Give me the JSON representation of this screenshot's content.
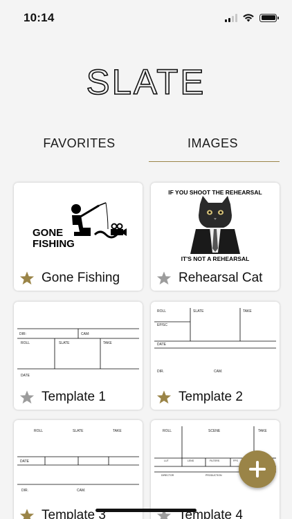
{
  "status_bar": {
    "time": "10:14",
    "icons": [
      "signal-icon",
      "wifi-icon",
      "battery-icon"
    ]
  },
  "app": {
    "logo_text": "SLATE",
    "accent_color": "#9a8447"
  },
  "tabs": [
    {
      "label": "FAVORITES",
      "active": false
    },
    {
      "label": "IMAGES",
      "active": true
    }
  ],
  "cards": [
    {
      "title": "Gone Fishing",
      "favorite": true,
      "image_text": [
        "GONE",
        "FISHING"
      ]
    },
    {
      "title": "Rehearsal Cat",
      "favorite": false,
      "image_text": [
        "IF YOU SHOOT THE REHEARSAL",
        "IT'S NOT A REHEARSAL"
      ]
    },
    {
      "title": "Template 1",
      "favorite": false,
      "image_text": [
        "DIR:",
        "CAM:",
        "ROLL",
        "SLATE",
        "TAKE",
        "DATE"
      ]
    },
    {
      "title": "Template 2",
      "favorite": true,
      "image_text": [
        "ROLL",
        "SLATE",
        "TAKE",
        "EP/SC",
        "DATE",
        "DIR.",
        "CAM."
      ]
    },
    {
      "title": "Template 3",
      "favorite": true,
      "image_text": [
        "ROLL",
        "SLATE",
        "TAKE",
        "DATE",
        "DIR.",
        "CAM."
      ]
    },
    {
      "title": "Template 4",
      "favorite": false,
      "image_text": [
        "ROLL",
        "SCENE",
        "TAKE",
        "LUT",
        "LENS",
        "FILTERS",
        "FPS",
        "DIRECTOR",
        "PRODUCTION"
      ]
    }
  ],
  "fab": {
    "icon": "plus-icon"
  }
}
